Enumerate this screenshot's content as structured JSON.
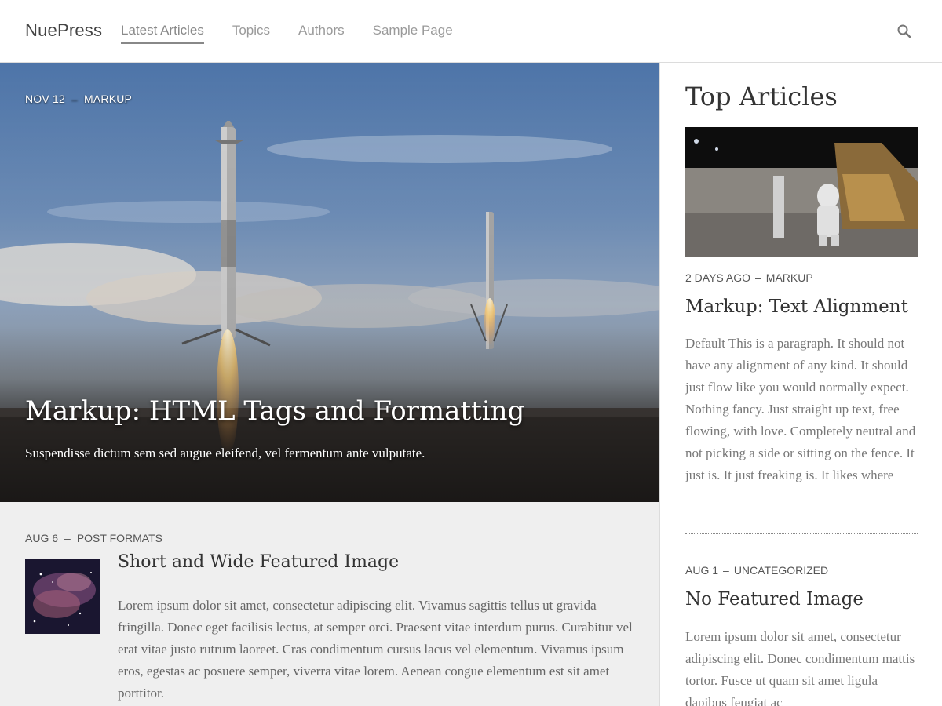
{
  "header": {
    "brand": "NuePress",
    "nav": [
      {
        "label": "Latest Articles",
        "active": true
      },
      {
        "label": "Topics",
        "active": false
      },
      {
        "label": "Authors",
        "active": false
      },
      {
        "label": "Sample Page",
        "active": false
      }
    ],
    "search_icon": "search-icon"
  },
  "hero": {
    "date": "NOV 12",
    "separator": "–",
    "category": "MARKUP",
    "title": "Markup: HTML Tags and Formatting",
    "subtitle": "Suspendisse dictum sem sed augue eleifend, vel fermentum ante vulputate."
  },
  "posts": [
    {
      "date": "AUG 6",
      "separator": "–",
      "category": "POST FORMATS",
      "title": "Short and Wide Featured Image",
      "excerpt": "Lorem ipsum dolor sit amet, consectetur adipiscing elit. Vivamus sagittis tellus ut gravida fringilla. Donec eget facilisis lectus, at semper orci. Praesent vitae interdum purus. Curabitur vel erat vitae justo rutrum laoreet. Cras condimentum cursus lacus vel elementum. Vivamus ipsum eros, egestas ac posuere semper, viverra vitae lorem. Aenean congue elementum est sit amet porttitor."
    }
  ],
  "sidebar": {
    "heading": "Top Articles",
    "articles": [
      {
        "date": "2 DAYS AGO",
        "separator": "–",
        "category": "MARKUP",
        "title": "Markup: Text Alignment",
        "excerpt": "Default This is a paragraph. It should not have any alignment of any kind. It should just flow like you would normally expect. Nothing fancy. Just straight up text, free flowing, with love. Completely neutral and not picking a side or sitting on the fence. It just is. It just freaking is. It likes where"
      },
      {
        "date": "AUG 1",
        "separator": "–",
        "category": "UNCATEGORIZED",
        "title": "No Featured Image",
        "excerpt": "Lorem ipsum dolor sit amet, consectetur adipiscing elit. Donec condimentum mattis tortor. Fusce ut quam sit amet ligula dapibus feugiat ac"
      }
    ]
  }
}
